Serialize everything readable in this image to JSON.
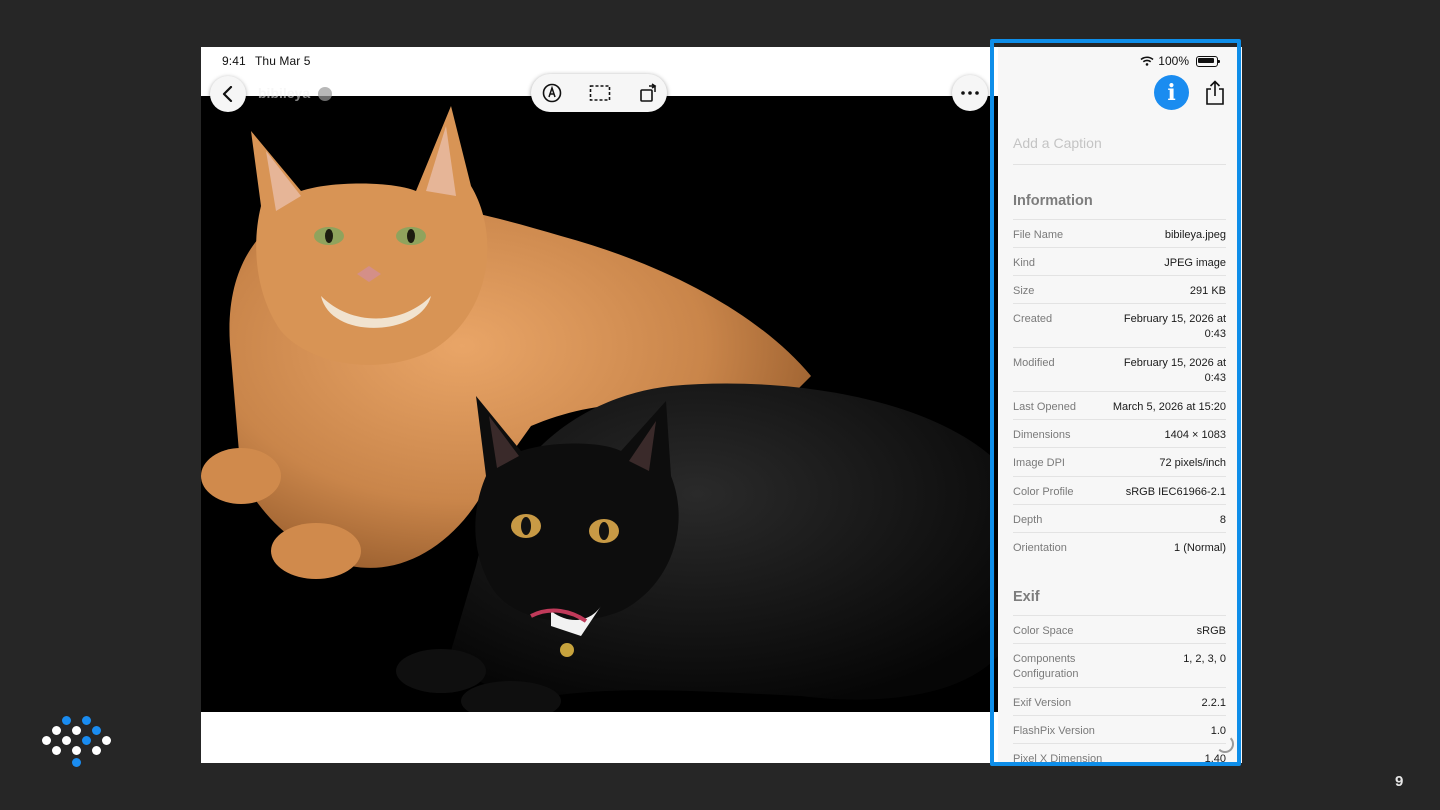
{
  "status": {
    "time": "9:41",
    "date": "Thu Mar 5",
    "battery": "100%"
  },
  "document": {
    "title": "bibileya"
  },
  "icons": {
    "back": "chevron-left-icon",
    "markup": "markup-pen-icon",
    "crop": "selection-icon",
    "rotate": "rotate-icon",
    "more": "ellipsis-icon",
    "info": "info-icon",
    "share": "share-icon",
    "wifi": "wifi-icon"
  },
  "panel": {
    "info_glyph": "i",
    "caption_placeholder": "Add a Caption",
    "information": {
      "heading": "Information",
      "rows": [
        {
          "key": "File Name",
          "value": "bibileya.jpeg"
        },
        {
          "key": "Kind",
          "value": "JPEG image"
        },
        {
          "key": "Size",
          "value": "291 KB"
        },
        {
          "key": "Created",
          "value": "February 15, 2026 at 0:43"
        },
        {
          "key": "Modified",
          "value": "February 15, 2026 at 0:43"
        },
        {
          "key": "Last Opened",
          "value": "March 5, 2026 at 15:20"
        },
        {
          "key": "Dimensions",
          "value": "1404 × 1083"
        },
        {
          "key": "Image DPI",
          "value": "72 pixels/inch"
        },
        {
          "key": "Color Profile",
          "value": "sRGB IEC61966-2.1"
        },
        {
          "key": "Depth",
          "value": "8"
        },
        {
          "key": "Orientation",
          "value": "1 (Normal)"
        }
      ]
    },
    "exif": {
      "heading": "Exif",
      "rows": [
        {
          "key": "Color Space",
          "value": "sRGB"
        },
        {
          "key": "Components Configuration",
          "value": "1, 2, 3, 0"
        },
        {
          "key": "Exif Version",
          "value": "2.2.1"
        },
        {
          "key": "FlashPix Version",
          "value": "1.0"
        },
        {
          "key": "Pixel X Dimension",
          "value": "1,40"
        }
      ]
    }
  },
  "slide": {
    "page_number": "9"
  },
  "colors": {
    "accent": "#0e8ee9",
    "info_button": "#1a8cf0",
    "background": "#262626"
  }
}
